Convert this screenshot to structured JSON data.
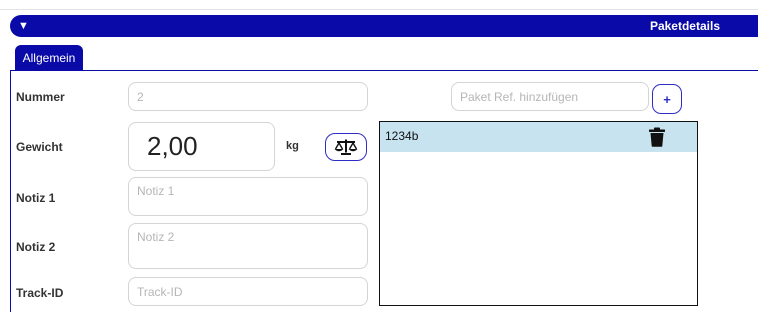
{
  "panel": {
    "title": "Paketdetails",
    "toggle_icon": "triangle-down-icon",
    "accent_color": "#0a0aa8"
  },
  "tabs": [
    {
      "label": "Allgemein",
      "active": true
    }
  ],
  "form": {
    "nummer": {
      "label": "Nummer",
      "value": "",
      "placeholder": "2"
    },
    "gewicht": {
      "label": "Gewicht",
      "value": "2,00",
      "unit": "kg"
    },
    "notiz1": {
      "label": "Notiz 1",
      "value": "",
      "placeholder": "Notiz 1"
    },
    "notiz2": {
      "label": "Notiz 2",
      "value": "",
      "placeholder": "Notiz 2"
    },
    "track_id": {
      "label": "Track-ID",
      "value": "",
      "placeholder": "Track-ID"
    }
  },
  "refs": {
    "input_placeholder": "Paket Ref. hinzufügen",
    "add_label": "+",
    "items": [
      {
        "label": "1234b",
        "selected_color": "#c6e3ef"
      }
    ]
  }
}
